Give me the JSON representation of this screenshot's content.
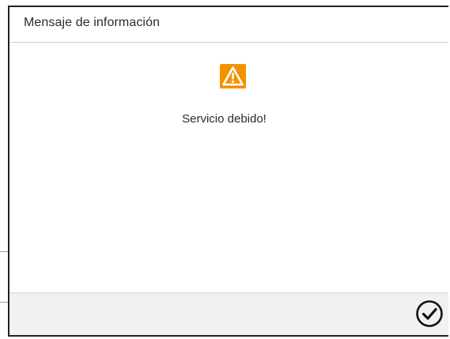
{
  "dialog": {
    "title": "Mensaje de información",
    "message": "Servicio debido!",
    "icon": "warning-icon",
    "accent_color": "#f39200",
    "confirm_icon": "check-circle-icon"
  }
}
